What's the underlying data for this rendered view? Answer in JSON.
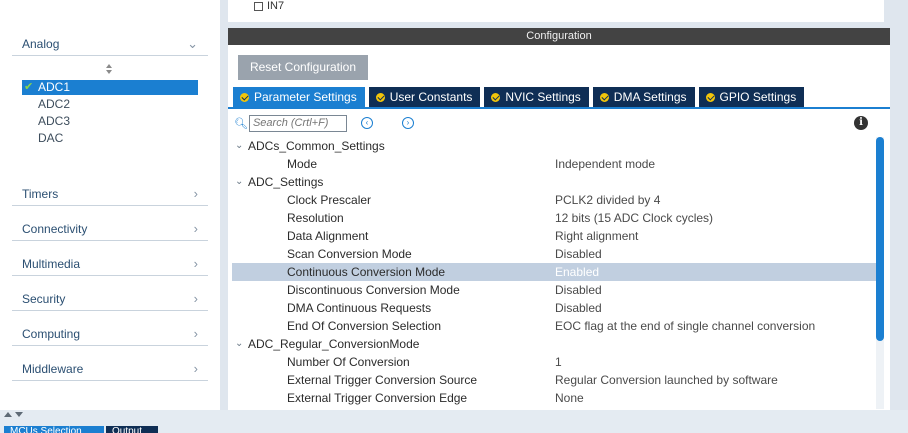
{
  "sidebar": {
    "categories": [
      {
        "label": "Analog",
        "chevron": "chevron-down"
      },
      {
        "label": "Timers",
        "chevron": "chevron-right"
      },
      {
        "label": "Connectivity",
        "chevron": "chevron-right"
      },
      {
        "label": "Multimedia",
        "chevron": "chevron-right"
      },
      {
        "label": "Security",
        "chevron": "chevron-right"
      },
      {
        "label": "Computing",
        "chevron": "chevron-right"
      },
      {
        "label": "Middleware",
        "chevron": "chevron-right"
      }
    ],
    "peripherals": [
      {
        "label": "ADC1",
        "selected": true,
        "checked": true
      },
      {
        "label": "ADC2",
        "selected": false,
        "checked": false
      },
      {
        "label": "ADC3",
        "selected": false,
        "checked": false
      },
      {
        "label": "DAC",
        "selected": false,
        "checked": false
      }
    ]
  },
  "top": {
    "input_label": "IN7"
  },
  "config": {
    "title": "Configuration",
    "reset_label": "Reset Configuration",
    "tabs": [
      {
        "label": "Parameter Settings",
        "active": true
      },
      {
        "label": "User Constants",
        "active": false
      },
      {
        "label": "NVIC Settings",
        "active": false
      },
      {
        "label": "DMA Settings",
        "active": false
      },
      {
        "label": "GPIO Settings",
        "active": false
      }
    ],
    "search_placeholder": "Search (Crtl+F)",
    "info_glyph": "i",
    "groups": [
      {
        "name": "ADCs_Common_Settings",
        "params": [
          {
            "name": "Mode",
            "value": "Independent mode"
          }
        ]
      },
      {
        "name": "ADC_Settings",
        "params": [
          {
            "name": "Clock Prescaler",
            "value": "PCLK2 divided by 4"
          },
          {
            "name": "Resolution",
            "value": "12 bits (15 ADC Clock cycles)"
          },
          {
            "name": "Data Alignment",
            "value": "Right alignment"
          },
          {
            "name": "Scan Conversion Mode",
            "value": "Disabled"
          },
          {
            "name": "Continuous Conversion Mode",
            "value": "Enabled",
            "highlighted": true
          },
          {
            "name": "Discontinuous Conversion Mode",
            "value": "Disabled"
          },
          {
            "name": "DMA Continuous Requests",
            "value": "Disabled"
          },
          {
            "name": "End Of Conversion Selection",
            "value": "EOC flag at the end of single channel conversion"
          }
        ]
      },
      {
        "name": "ADC_Regular_ConversionMode",
        "params": [
          {
            "name": "Number Of Conversion",
            "value": "1"
          },
          {
            "name": "External Trigger Conversion Source",
            "value": "Regular Conversion launched by software"
          },
          {
            "name": "External Trigger Conversion Edge",
            "value": "None"
          }
        ]
      }
    ]
  },
  "bottom": {
    "tabs": [
      "MCUs Selection",
      "Output"
    ]
  },
  "colors": {
    "accent": "#1b7fd1",
    "tab_dark": "#0f2e55",
    "highlight_row": "#c1cfe0",
    "title_bar": "#434343",
    "tab_check": "#f2c50a"
  }
}
